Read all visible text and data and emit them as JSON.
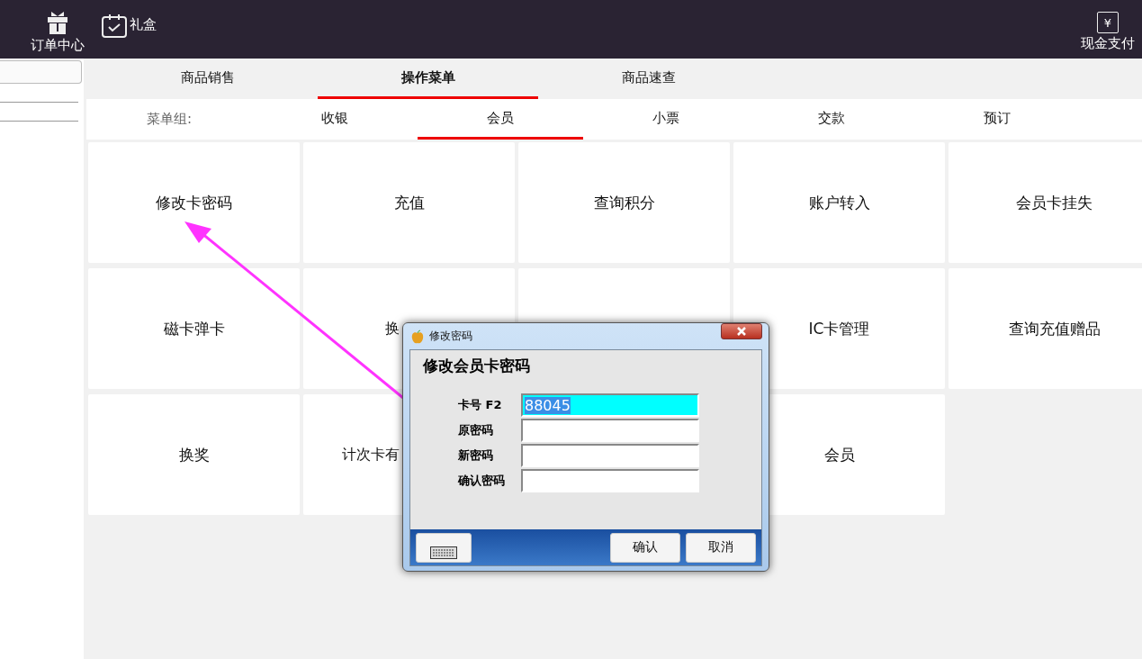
{
  "topbar": {
    "left": [
      {
        "label": "订单中心",
        "kind": "gift"
      },
      {
        "label": "礼盒",
        "kind": "calendar"
      }
    ],
    "right": {
      "label": "现金支付",
      "icon": "¥"
    }
  },
  "tabs": [
    {
      "label": "商品销售",
      "selected": false
    },
    {
      "label": "操作菜单",
      "selected": true
    },
    {
      "label": "商品速查",
      "selected": false
    }
  ],
  "menu_group": {
    "label": "菜单组:",
    "items": [
      {
        "label": "收银",
        "selected": false
      },
      {
        "label": "会员",
        "selected": true
      },
      {
        "label": "小票",
        "selected": false
      },
      {
        "label": "交款",
        "selected": false
      },
      {
        "label": "预订",
        "selected": false
      }
    ]
  },
  "tiles": [
    {
      "label": "修改卡密码"
    },
    {
      "label": "充值"
    },
    {
      "label": "查询积分"
    },
    {
      "label": "账户转入"
    },
    {
      "label": "会员卡挂失"
    },
    {
      "label": "磁卡弹卡"
    },
    {
      "label": "换",
      "kind": "partial"
    },
    {
      "kind": "covered"
    },
    {
      "label": "IC卡管理"
    },
    {
      "label": "查询充值赠品"
    },
    {
      "label": "换奖"
    },
    {
      "label": "计次卡有",
      "kind": "partial"
    },
    {
      "kind": "hidden"
    },
    {
      "label": "会员"
    }
  ],
  "dialog": {
    "title": "修改密码",
    "heading": "修改会员卡密码",
    "fields": [
      {
        "label": "卡号 F2",
        "value": "88045",
        "focused": true
      },
      {
        "label": "原密码",
        "focused": false
      },
      {
        "label": "新密码",
        "focused": false
      },
      {
        "label": "确认密码",
        "focused": false
      }
    ],
    "buttons": [
      "确认",
      "取消"
    ]
  }
}
